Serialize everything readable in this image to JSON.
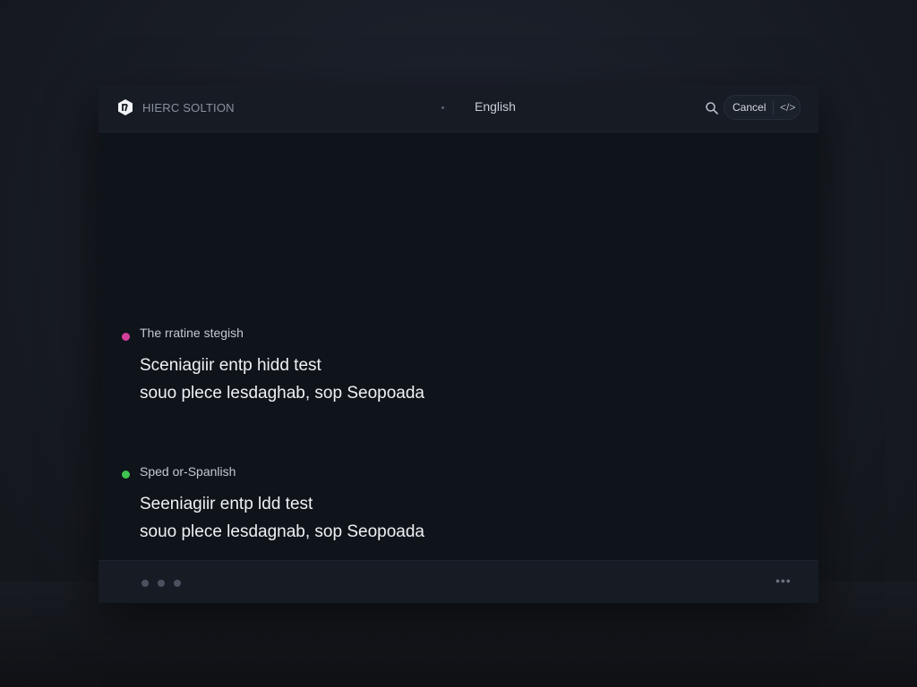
{
  "header": {
    "brand": "HIERC SOLTION",
    "language": "English",
    "cancel_label": "Cancel",
    "pill_icon": "</>"
  },
  "sections": [
    {
      "label": "The rratine stegish",
      "dot_color": "#d23f9a",
      "lines": [
        "Sceniagiir entp hidd test",
        "souo plece lesdaghab, sop Seopoada"
      ]
    },
    {
      "label": "Sped or-Spanlish",
      "dot_color": "#3ec44f",
      "lines": [
        "Seeniagiir entp ldd test",
        "souo plece lesdagnab, sop Seopoada"
      ]
    }
  ],
  "footer": {
    "more_label": "•••"
  },
  "icons": {
    "logo": "logo-icon",
    "search": "search-icon",
    "code": "code-icon"
  }
}
